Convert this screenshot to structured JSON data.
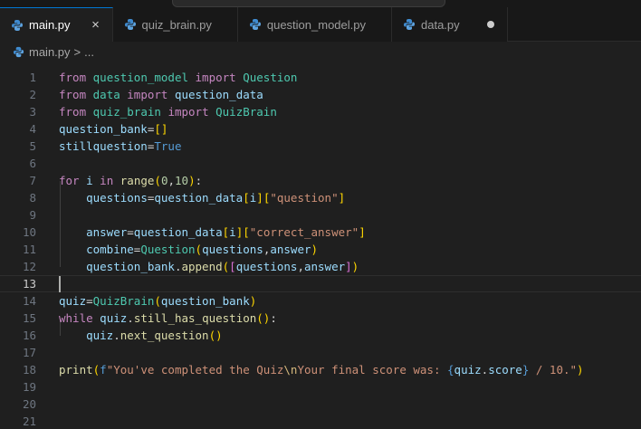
{
  "tabs": [
    {
      "label": "main.py",
      "active": true,
      "close_glyph": "×"
    },
    {
      "label": "quiz_brain.py",
      "active": false
    },
    {
      "label": "question_model.py",
      "active": false
    },
    {
      "label": "data.py",
      "active": false,
      "dirty": true
    }
  ],
  "breadcrumb": {
    "file": "main.py",
    "separator": ">",
    "more": "..."
  },
  "editor": {
    "current_line": 13,
    "line_numbers": [
      "1",
      "2",
      "3",
      "4",
      "5",
      "6",
      "7",
      "8",
      "9",
      "10",
      "11",
      "12",
      "13",
      "14",
      "15",
      "16",
      "17",
      "18",
      "19",
      "20",
      "21"
    ],
    "lines": [
      [
        {
          "t": "from",
          "c": "kw"
        },
        {
          "t": " "
        },
        {
          "t": "question_model",
          "c": "cls"
        },
        {
          "t": " "
        },
        {
          "t": "import",
          "c": "kw"
        },
        {
          "t": " "
        },
        {
          "t": "Question",
          "c": "cls"
        }
      ],
      [
        {
          "t": "from",
          "c": "kw"
        },
        {
          "t": " "
        },
        {
          "t": "data",
          "c": "cls"
        },
        {
          "t": " "
        },
        {
          "t": "import",
          "c": "kw"
        },
        {
          "t": " "
        },
        {
          "t": "question_data",
          "c": "var"
        }
      ],
      [
        {
          "t": "from",
          "c": "kw"
        },
        {
          "t": " "
        },
        {
          "t": "quiz_brain",
          "c": "cls"
        },
        {
          "t": " "
        },
        {
          "t": "import",
          "c": "kw"
        },
        {
          "t": " "
        },
        {
          "t": "QuizBrain",
          "c": "cls"
        }
      ],
      [
        {
          "t": "question_bank",
          "c": "var"
        },
        {
          "t": "=",
          "c": "op"
        },
        {
          "t": "[]",
          "c": "p1"
        }
      ],
      [
        {
          "t": "stillquestion",
          "c": "var"
        },
        {
          "t": "=",
          "c": "op"
        },
        {
          "t": "True",
          "c": "kw2"
        }
      ],
      [],
      [
        {
          "t": "for",
          "c": "kw"
        },
        {
          "t": " "
        },
        {
          "t": "i",
          "c": "var"
        },
        {
          "t": " "
        },
        {
          "t": "in",
          "c": "kw"
        },
        {
          "t": " "
        },
        {
          "t": "range",
          "c": "fn"
        },
        {
          "t": "(",
          "c": "p1"
        },
        {
          "t": "0",
          "c": "num"
        },
        {
          "t": ",",
          "c": "op"
        },
        {
          "t": "10",
          "c": "num"
        },
        {
          "t": ")",
          "c": "p1"
        },
        {
          "t": ":",
          "c": "op"
        }
      ],
      [
        {
          "t": "    "
        },
        {
          "t": "questions",
          "c": "var"
        },
        {
          "t": "=",
          "c": "op"
        },
        {
          "t": "question_data",
          "c": "var"
        },
        {
          "t": "[",
          "c": "p1"
        },
        {
          "t": "i",
          "c": "var"
        },
        {
          "t": "]",
          "c": "p1"
        },
        {
          "t": "[",
          "c": "p1"
        },
        {
          "t": "\"question\"",
          "c": "str"
        },
        {
          "t": "]",
          "c": "p1"
        }
      ],
      [],
      [
        {
          "t": "    "
        },
        {
          "t": "answer",
          "c": "var"
        },
        {
          "t": "=",
          "c": "op"
        },
        {
          "t": "question_data",
          "c": "var"
        },
        {
          "t": "[",
          "c": "p1"
        },
        {
          "t": "i",
          "c": "var"
        },
        {
          "t": "]",
          "c": "p1"
        },
        {
          "t": "[",
          "c": "p1"
        },
        {
          "t": "\"correct_answer\"",
          "c": "str"
        },
        {
          "t": "]",
          "c": "p1"
        }
      ],
      [
        {
          "t": "    "
        },
        {
          "t": "combine",
          "c": "var"
        },
        {
          "t": "=",
          "c": "op"
        },
        {
          "t": "Question",
          "c": "cls"
        },
        {
          "t": "(",
          "c": "p1"
        },
        {
          "t": "questions",
          "c": "var"
        },
        {
          "t": ",",
          "c": "op"
        },
        {
          "t": "answer",
          "c": "var"
        },
        {
          "t": ")",
          "c": "p1"
        }
      ],
      [
        {
          "t": "    "
        },
        {
          "t": "question_bank",
          "c": "var"
        },
        {
          "t": ".",
          "c": "op"
        },
        {
          "t": "append",
          "c": "fn"
        },
        {
          "t": "(",
          "c": "p1"
        },
        {
          "t": "[",
          "c": "p2"
        },
        {
          "t": "questions",
          "c": "var"
        },
        {
          "t": ",",
          "c": "op"
        },
        {
          "t": "answer",
          "c": "var"
        },
        {
          "t": "]",
          "c": "p2"
        },
        {
          "t": ")",
          "c": "p1"
        }
      ],
      [],
      [
        {
          "t": "quiz",
          "c": "var"
        },
        {
          "t": "=",
          "c": "op"
        },
        {
          "t": "QuizBrain",
          "c": "cls"
        },
        {
          "t": "(",
          "c": "p1"
        },
        {
          "t": "question_bank",
          "c": "var"
        },
        {
          "t": ")",
          "c": "p1"
        }
      ],
      [
        {
          "t": "while",
          "c": "kw"
        },
        {
          "t": " "
        },
        {
          "t": "quiz",
          "c": "var"
        },
        {
          "t": ".",
          "c": "op"
        },
        {
          "t": "still_has_question",
          "c": "fn"
        },
        {
          "t": "()",
          "c": "p1"
        },
        {
          "t": ":",
          "c": "op"
        }
      ],
      [
        {
          "t": "    "
        },
        {
          "t": "quiz",
          "c": "var"
        },
        {
          "t": ".",
          "c": "op"
        },
        {
          "t": "next_question",
          "c": "fn"
        },
        {
          "t": "()",
          "c": "p1"
        }
      ],
      [],
      [
        {
          "t": "print",
          "c": "fn"
        },
        {
          "t": "(",
          "c": "p1"
        },
        {
          "t": "f",
          "c": "kw2"
        },
        {
          "t": "\"You've completed the Quiz",
          "c": "str"
        },
        {
          "t": "\\n",
          "c": "esc"
        },
        {
          "t": "Your final score was: ",
          "c": "str"
        },
        {
          "t": "{",
          "c": "kw2"
        },
        {
          "t": "quiz",
          "c": "var"
        },
        {
          "t": ".",
          "c": "op"
        },
        {
          "t": "score",
          "c": "var"
        },
        {
          "t": "}",
          "c": "kw2"
        },
        {
          "t": " / 10.\"",
          "c": "str"
        },
        {
          "t": ")",
          "c": "p1"
        }
      ],
      [],
      [],
      []
    ]
  }
}
